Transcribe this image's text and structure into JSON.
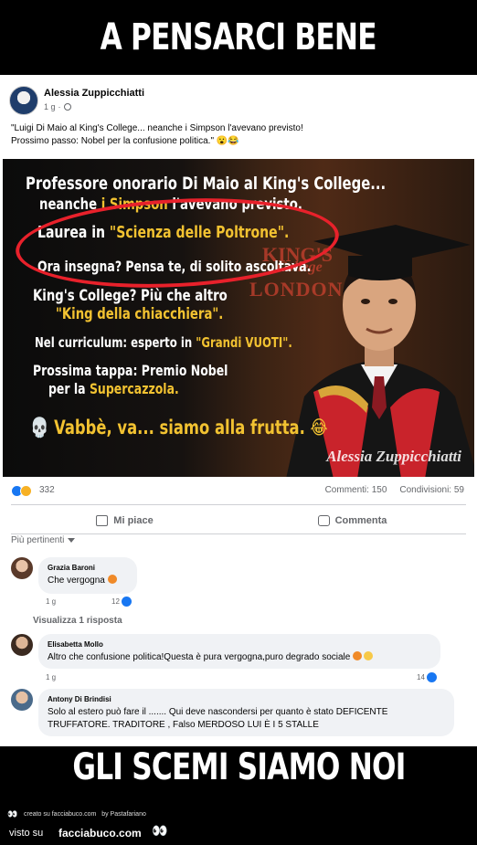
{
  "meme": {
    "top_caption": "A PENSARCI BENE",
    "bottom_caption": "GLI SCEMI SIAMO NOI",
    "footer_created": "creato su facciabuco.com",
    "footer_by": "by Pastafariano",
    "footer_visto_su": "visto su",
    "footer_brand": "facciabuco.com"
  },
  "post": {
    "author": "Alessia Zuppicchiatti",
    "time": "1 g",
    "text_line1": "\"Luigi Di Maio al King's College... neanche i Simpson l'avevano previsto!",
    "text_line2": "Prossimo passo: Nobel per la confusione politica.\" 😮😂"
  },
  "image": {
    "line1": "Professore onorario Di Maio al King's College...",
    "line2a": "neanche ",
    "line2b": "i Simpson",
    "line2c": " l'avevano previsto.",
    "line3a": "Laurea in ",
    "line3b": "\"Scienza delle Poltrone\".",
    "line4": "Ora insegna? Pensa te, di solito ascoltava.",
    "line5": "King's College? Più che altro",
    "line6": "\"King della chiacchiera\".",
    "line7a": "Nel curriculum: esperto in ",
    "line7b": "\"Grandi VUOTI\".",
    "line8": "Prossima tappa: Premio Nobel",
    "line9a": "per la ",
    "line9b": "Supercazzola.",
    "line10": "💀 Vabbè, va... siamo alla frutta. 😂",
    "sign1": "KING'S",
    "sign2": "College",
    "sign3": "LONDON",
    "signature": "Alessia Zuppicchiatti"
  },
  "stats": {
    "reactions": "332",
    "comments": "Commenti: 150",
    "shares": "Condivisioni: 59"
  },
  "actions": {
    "like": "Mi piace",
    "comment": "Commenta"
  },
  "sort": {
    "label": "Più pertinenti"
  },
  "comments": [
    {
      "name": "Grazia Baroni",
      "text": "Che vergogna",
      "time": "1 g",
      "likes": "12"
    },
    {
      "reply_link": "Visualizza 1 risposta"
    },
    {
      "name": "Elisabetta Mollo",
      "text": "Altro che confusione politica!Questa è pura vergogna,puro degrado sociale",
      "time": "1 g",
      "likes": "14"
    },
    {
      "name": "Antony Di Brindisi",
      "text1": "Solo al estero può fare il ....... Qui deve nascondersi per quanto è stato DEFICENTE",
      "text2": "TRUFFATORE. TRADITORE , Falso MERDOSO LUI È I 5 STALLE"
    }
  ],
  "colors": {
    "facebook_blue": "#1877f2",
    "highlight_yellow": "#f2c231",
    "annotation_red": "#e8212b"
  }
}
